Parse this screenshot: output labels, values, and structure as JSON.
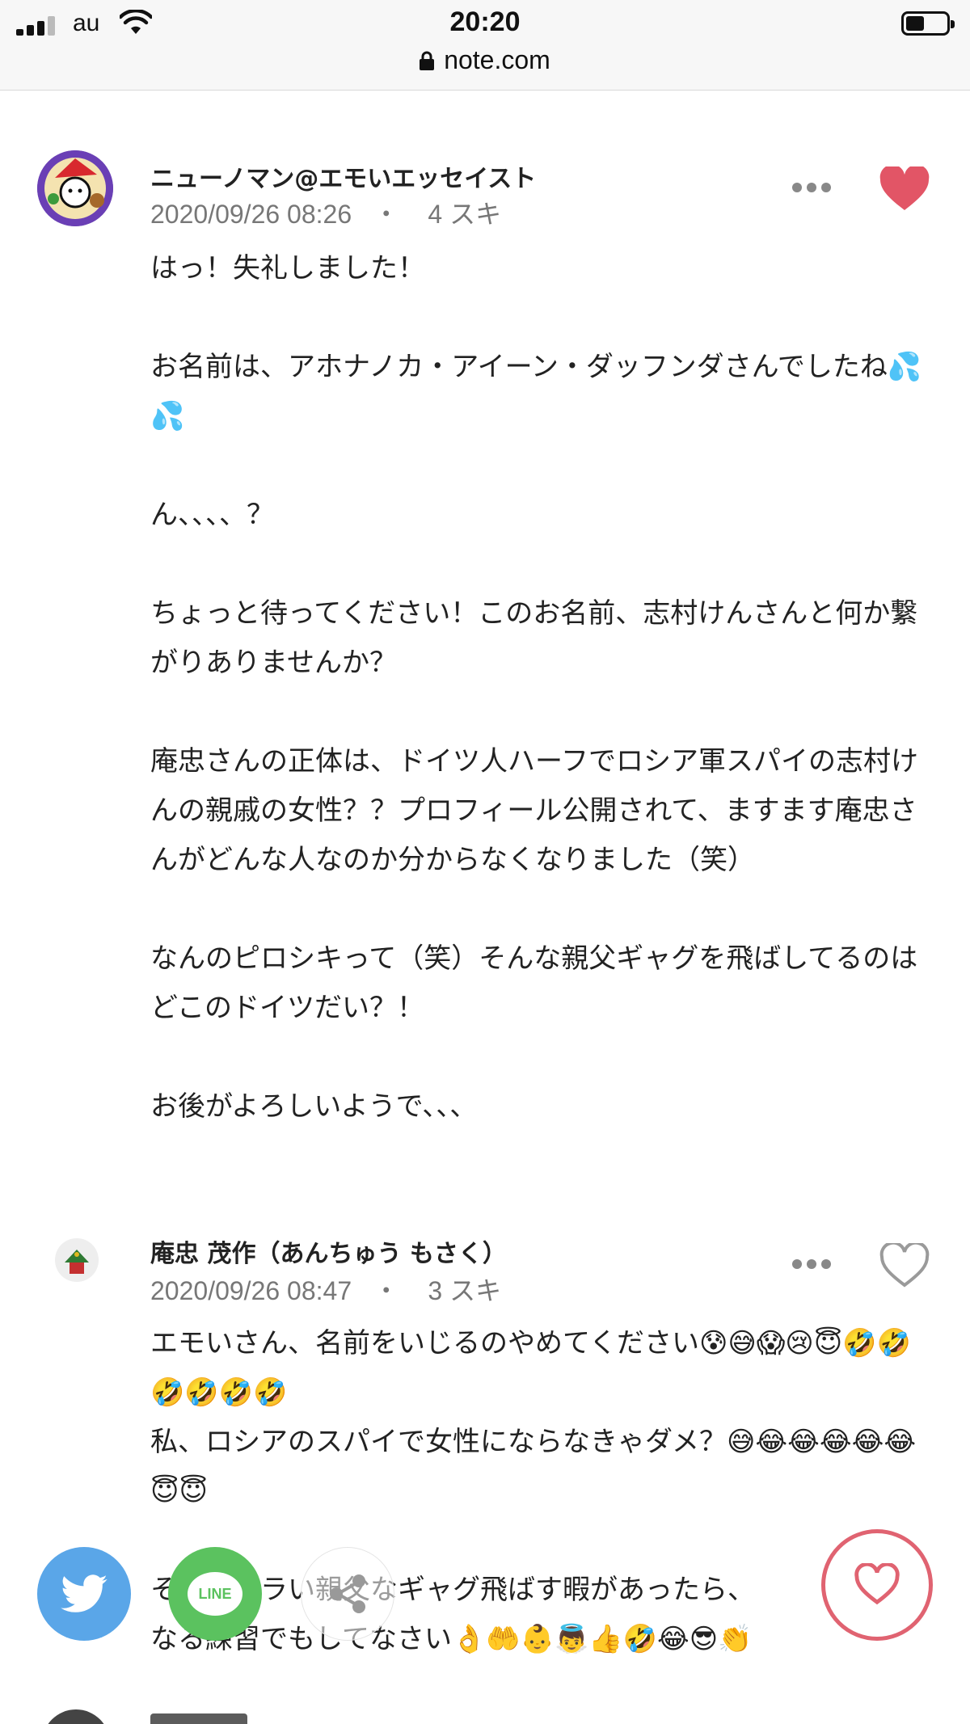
{
  "status_bar": {
    "carrier": "au",
    "time": "20:20"
  },
  "url_bar": {
    "domain": "note.com"
  },
  "comments": [
    {
      "author": "ニューノマン@エモいエッセイスト",
      "date": "2020/09/26 08:26",
      "likes": "4 スキ",
      "liked": true,
      "body": "はっ！失礼しました！\n\nお名前は、アホナノカ・アイーン・ダッフンダさんでしたね💦💦\n\nん、、、、？\n\nちょっと待ってください！このお名前、志村けんさんと何か繋がりありませんか？\n\n庵忠さんの正体は、ドイツ人ハーフでロシア軍スパイの志村けんの親戚の女性？？プロフィール公開されて、ますます庵忠さんがどんな人なのか分からなくなりました（笑）\n\nなんのピロシキって（笑）そんな親父ギャグを飛ばしてるのはどこのドイツだい？！\n\nお後がよろしいようで、、、"
    },
    {
      "author": "庵忠 茂作（あんちゅう もさく）",
      "date": "2020/09/26 08:47",
      "likes": "3 スキ",
      "liked": false,
      "body": "エモいさん、名前をいじるのやめてください😰😅😱😢😇🤣🤣🤣🤣🤣🤣\n私、ロシアのスパイで女性にならなきゃダメ？😅😂😂😂😂😂😇😇\n\nそんなツラい親父なギャグ飛ばす暇があったら、\nなる練習でもしてなさい👌🤲👶👼👍🤣😂😎👏"
    }
  ],
  "share": {
    "line_label": "LINE"
  },
  "colors": {
    "accent_heart": "#e25566",
    "twitter": "#5aa6e8",
    "line": "#5bc25f"
  },
  "icons": [
    "signal-icon",
    "wifi-icon",
    "battery-icon",
    "lock-icon",
    "more-icon",
    "heart-icon",
    "twitter-icon",
    "share-icon"
  ]
}
